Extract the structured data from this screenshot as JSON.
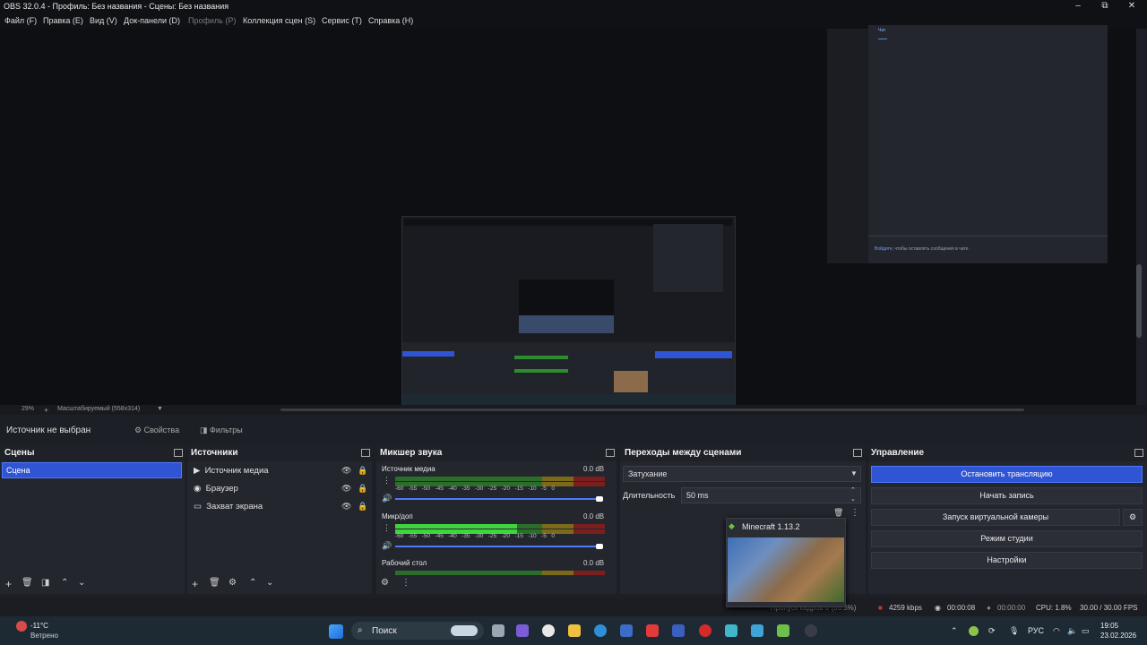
{
  "window": {
    "title": "OBS 32.0.4 - Профиль: Без названия - Сцены: Без названия",
    "min": "–",
    "max": "⧉",
    "close": "✕"
  },
  "menu": [
    "Файл (F)",
    "Правка (E)",
    "Вид (V)",
    "Док-панели (D)",
    "Профиль (P)",
    "Коллекция сцен (S)",
    "Сервис (T)",
    "Справка (H)"
  ],
  "chat": {
    "tab": "Чат",
    "login_link": "Войдите,",
    "login_rest": " чтобы оставлять сообщения в чате."
  },
  "preview": {
    "zoom": "29%",
    "plus": "+",
    "scale_mode": "Масштабируемый (558x314)",
    "dropdown": "▼"
  },
  "source_bar": {
    "no_source": "Источник не выбран",
    "properties": "Свойства",
    "filters": "Фильтры",
    "gear_icon": "⚙",
    "filter_icon": "◨"
  },
  "docks": {
    "scenes": {
      "title": "Сцены",
      "items": [
        "Сцена"
      ]
    },
    "sources": {
      "title": "Источники",
      "items": [
        {
          "icon": "▶",
          "label": "Источник медиа"
        },
        {
          "icon": "◉",
          "label": "Браузер"
        },
        {
          "icon": "▭",
          "label": "Захват экрана"
        }
      ]
    },
    "mixer": {
      "title": "Микшер звука",
      "channels": [
        {
          "name": "Источник медиа",
          "db": "0.0 dB",
          "level": 0
        },
        {
          "name": "Микр/доп",
          "db": "0.0 dB",
          "level": 0.58
        },
        {
          "name": "Рабочий стол",
          "db": "0.0 dB",
          "level": 0
        }
      ],
      "ticks": [
        "-60",
        "-55",
        "-50",
        "-45",
        "-40",
        "-35",
        "-30",
        "-25",
        "-20",
        "-15",
        "-10",
        "-5",
        "0"
      ]
    },
    "transitions": {
      "title": "Переходы между сценами",
      "selected": "Затухание",
      "duration_label": "Длительность",
      "duration_value": "50 ms"
    },
    "controls": {
      "title": "Управление",
      "buttons": [
        "Остановить трансляцию",
        "Начать запись",
        "Запуск виртуальной камеры",
        "Режим студии",
        "Настройки"
      ]
    }
  },
  "popup": {
    "title": "Minecraft 1.13.2"
  },
  "status": {
    "dropped": "Пропуск кадров 0 (86.3%)",
    "kbps": "4259 kbps",
    "stream_time": "00:00:08",
    "rec_time": "00:00:00",
    "cpu": "CPU: 1.8%",
    "fps": "30.00 / 30.00 FPS"
  },
  "taskbar": {
    "temp": "-11°C",
    "weather": "Ветрено",
    "search": "Поиск",
    "lang": "РУС",
    "time": "19:05",
    "date": "23.02.2026"
  },
  "colors": {
    "accent": "#2f55d4",
    "meter_green": "#2e8b2e",
    "meter_yellow": "#8a7a1e",
    "meter_red": "#8b2222"
  }
}
